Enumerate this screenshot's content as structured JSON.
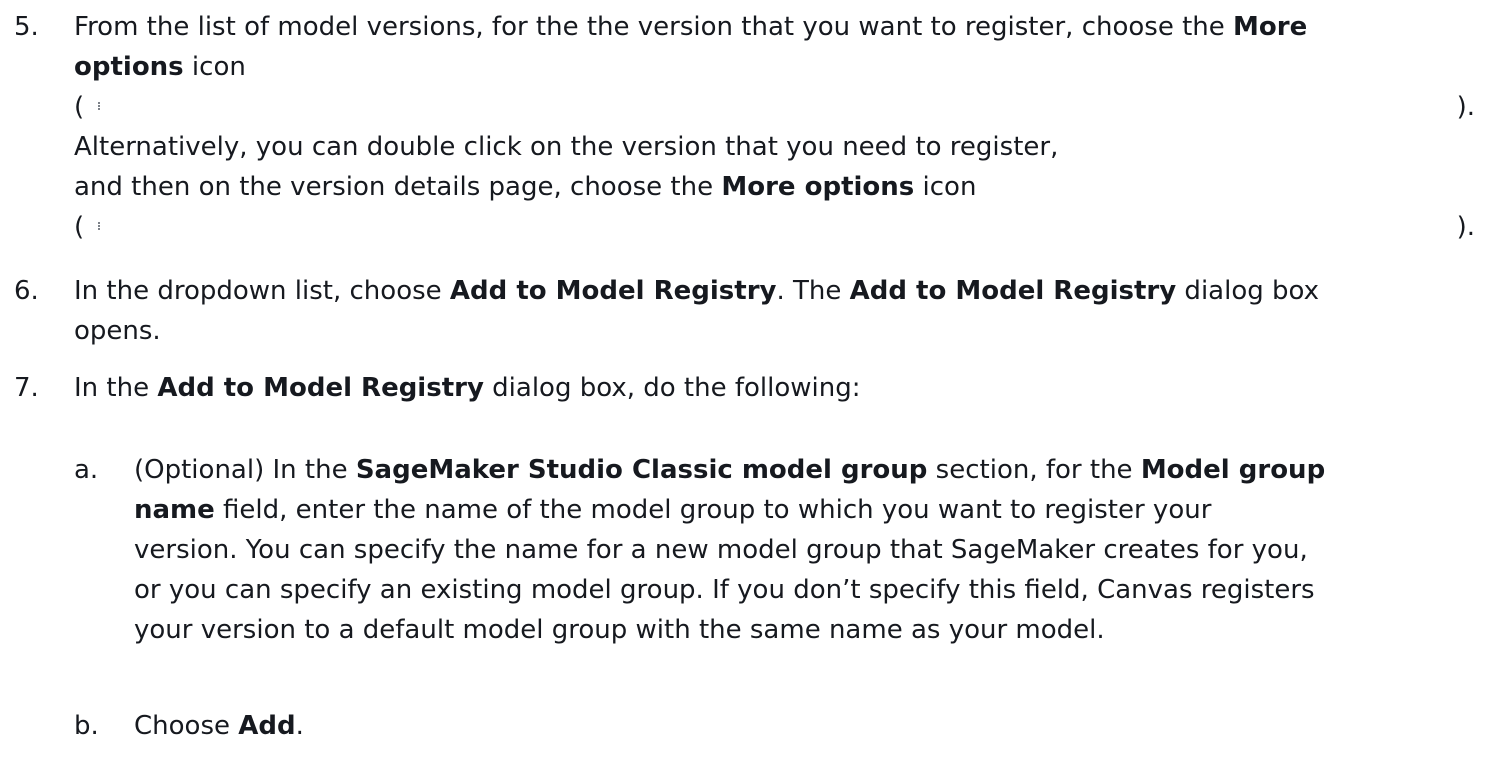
{
  "steps": [
    {
      "number": "5.",
      "line1_a": "From the list of model versions, for the the version that you want to register, choose the ",
      "line1_b": "More",
      "line2_a": "options",
      "line2_b": " icon",
      "open_paren": "(",
      "close_paren": ").",
      "line3": "Alternatively, you can double click on the version that you need to register,",
      "line4_a": "and then on the version details page, choose the ",
      "line4_b": "More options",
      "line4_c": " icon"
    },
    {
      "number": "6.",
      "line1_a": "In the dropdown list, choose ",
      "line1_b": "Add to Model Registry",
      "line1_c": ". The ",
      "line1_d": "Add to Model Registry",
      "line1_e": " dialog box",
      "line2": "opens."
    },
    {
      "number": "7.",
      "line1_a": "In the ",
      "line1_b": "Add to Model Registry",
      "line1_c": " dialog box, do the following:"
    }
  ],
  "substeps": [
    {
      "letter": "a.",
      "l1_a": "(Optional) In the ",
      "l1_b": "SageMaker Studio Classic model group",
      "l1_c": " section, for the ",
      "l1_d": "Model group",
      "l2_a": "name",
      "l2_b": " field, enter the name of the model group to which you want to register your",
      "l3": "version. You can specify the name for a new model group that SageMaker creates for you,",
      "l4": "or you can specify an existing model group. If you don’t specify this field, Canvas registers",
      "l5": "your version to a default model group with the same name as your model."
    },
    {
      "letter": "b.",
      "l1_a": "Choose ",
      "l1_b": "Add",
      "l1_c": "."
    }
  ],
  "icons": {
    "more_options": "more-options-icon"
  }
}
